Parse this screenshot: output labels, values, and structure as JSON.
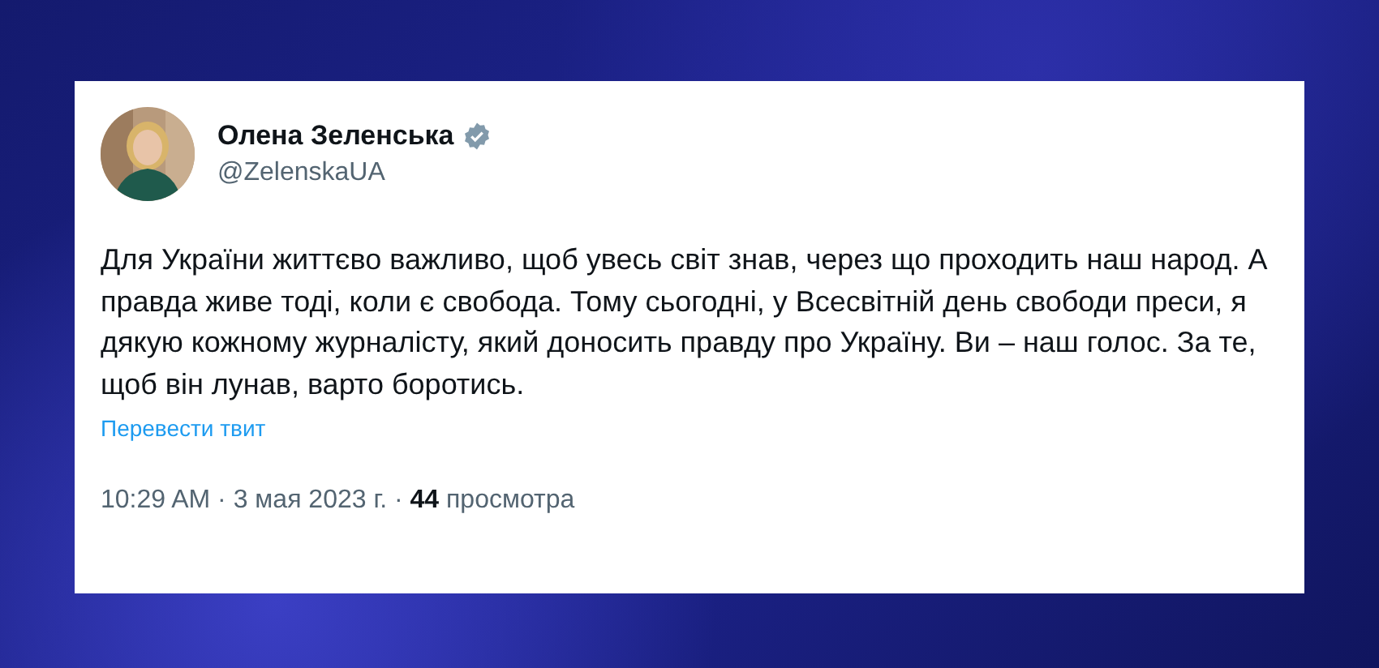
{
  "tweet": {
    "author": "Олена Зеленська",
    "verified": true,
    "handle": "@ZelenskaUA",
    "text": "Для України життєво важливо, щоб увесь світ знав, через що проходить наш народ. А правда живе тоді, коли є свобода. Тому сьогодні, у Всесвітній день свободи преси, я дякую кожному журналісту, який доносить правду про Україну. Ви – наш голос. За те, щоб він лунав, варто боротись.",
    "translate_link": "Перевести твит",
    "meta": "10:29 AM · 3 мая 2023 г. · **44** просмотра"
  }
}
